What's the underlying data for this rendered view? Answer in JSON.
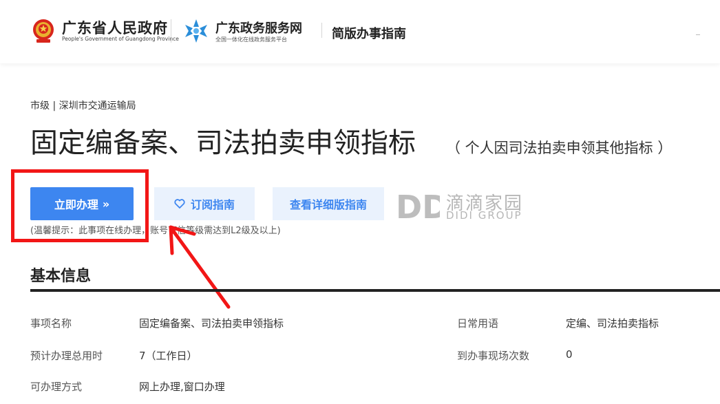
{
  "header": {
    "gov_name": "广东省人民政府",
    "gov_name_en": "People's Government of Guangdong Province",
    "portal_name": "广东政务服务网",
    "portal_sub": "全国一体化在线政务服务平台",
    "guide_title": "简版办事指南"
  },
  "breadcrumb": "市级 | 深圳市交通运输局",
  "title": "固定编备案、司法拍卖申领指标",
  "subtitle": "（ 个人因司法拍卖申领其他指标 ）",
  "actions": {
    "apply_label": "立即办理",
    "apply_arrow": "»",
    "subscribe_label": "订阅指南",
    "detail_label": "查看详细版指南"
  },
  "tip": "(温馨提示：此事项在线办理，账号可信等级需达到L2级及以上)",
  "watermark": {
    "mark": "DD",
    "cn": "滴滴家园",
    "en": "DIDI GROUP"
  },
  "section_title": "基本信息",
  "info": {
    "name_label": "事项名称",
    "name_value": "固定编备案、司法拍卖申领指标",
    "alias_label": "日常用语",
    "alias_value": "定编、司法拍卖指标",
    "time_label": "预计办理总用时",
    "time_value": "7（工作日）",
    "visits_label": "到办事现场次数",
    "visits_value": "0",
    "method_label": "可办理方式",
    "method_value": "网上办理,窗口办理"
  },
  "colors": {
    "primary": "#3d86f0",
    "light_bg": "#eaf2fd",
    "annotation": "#f21616"
  }
}
